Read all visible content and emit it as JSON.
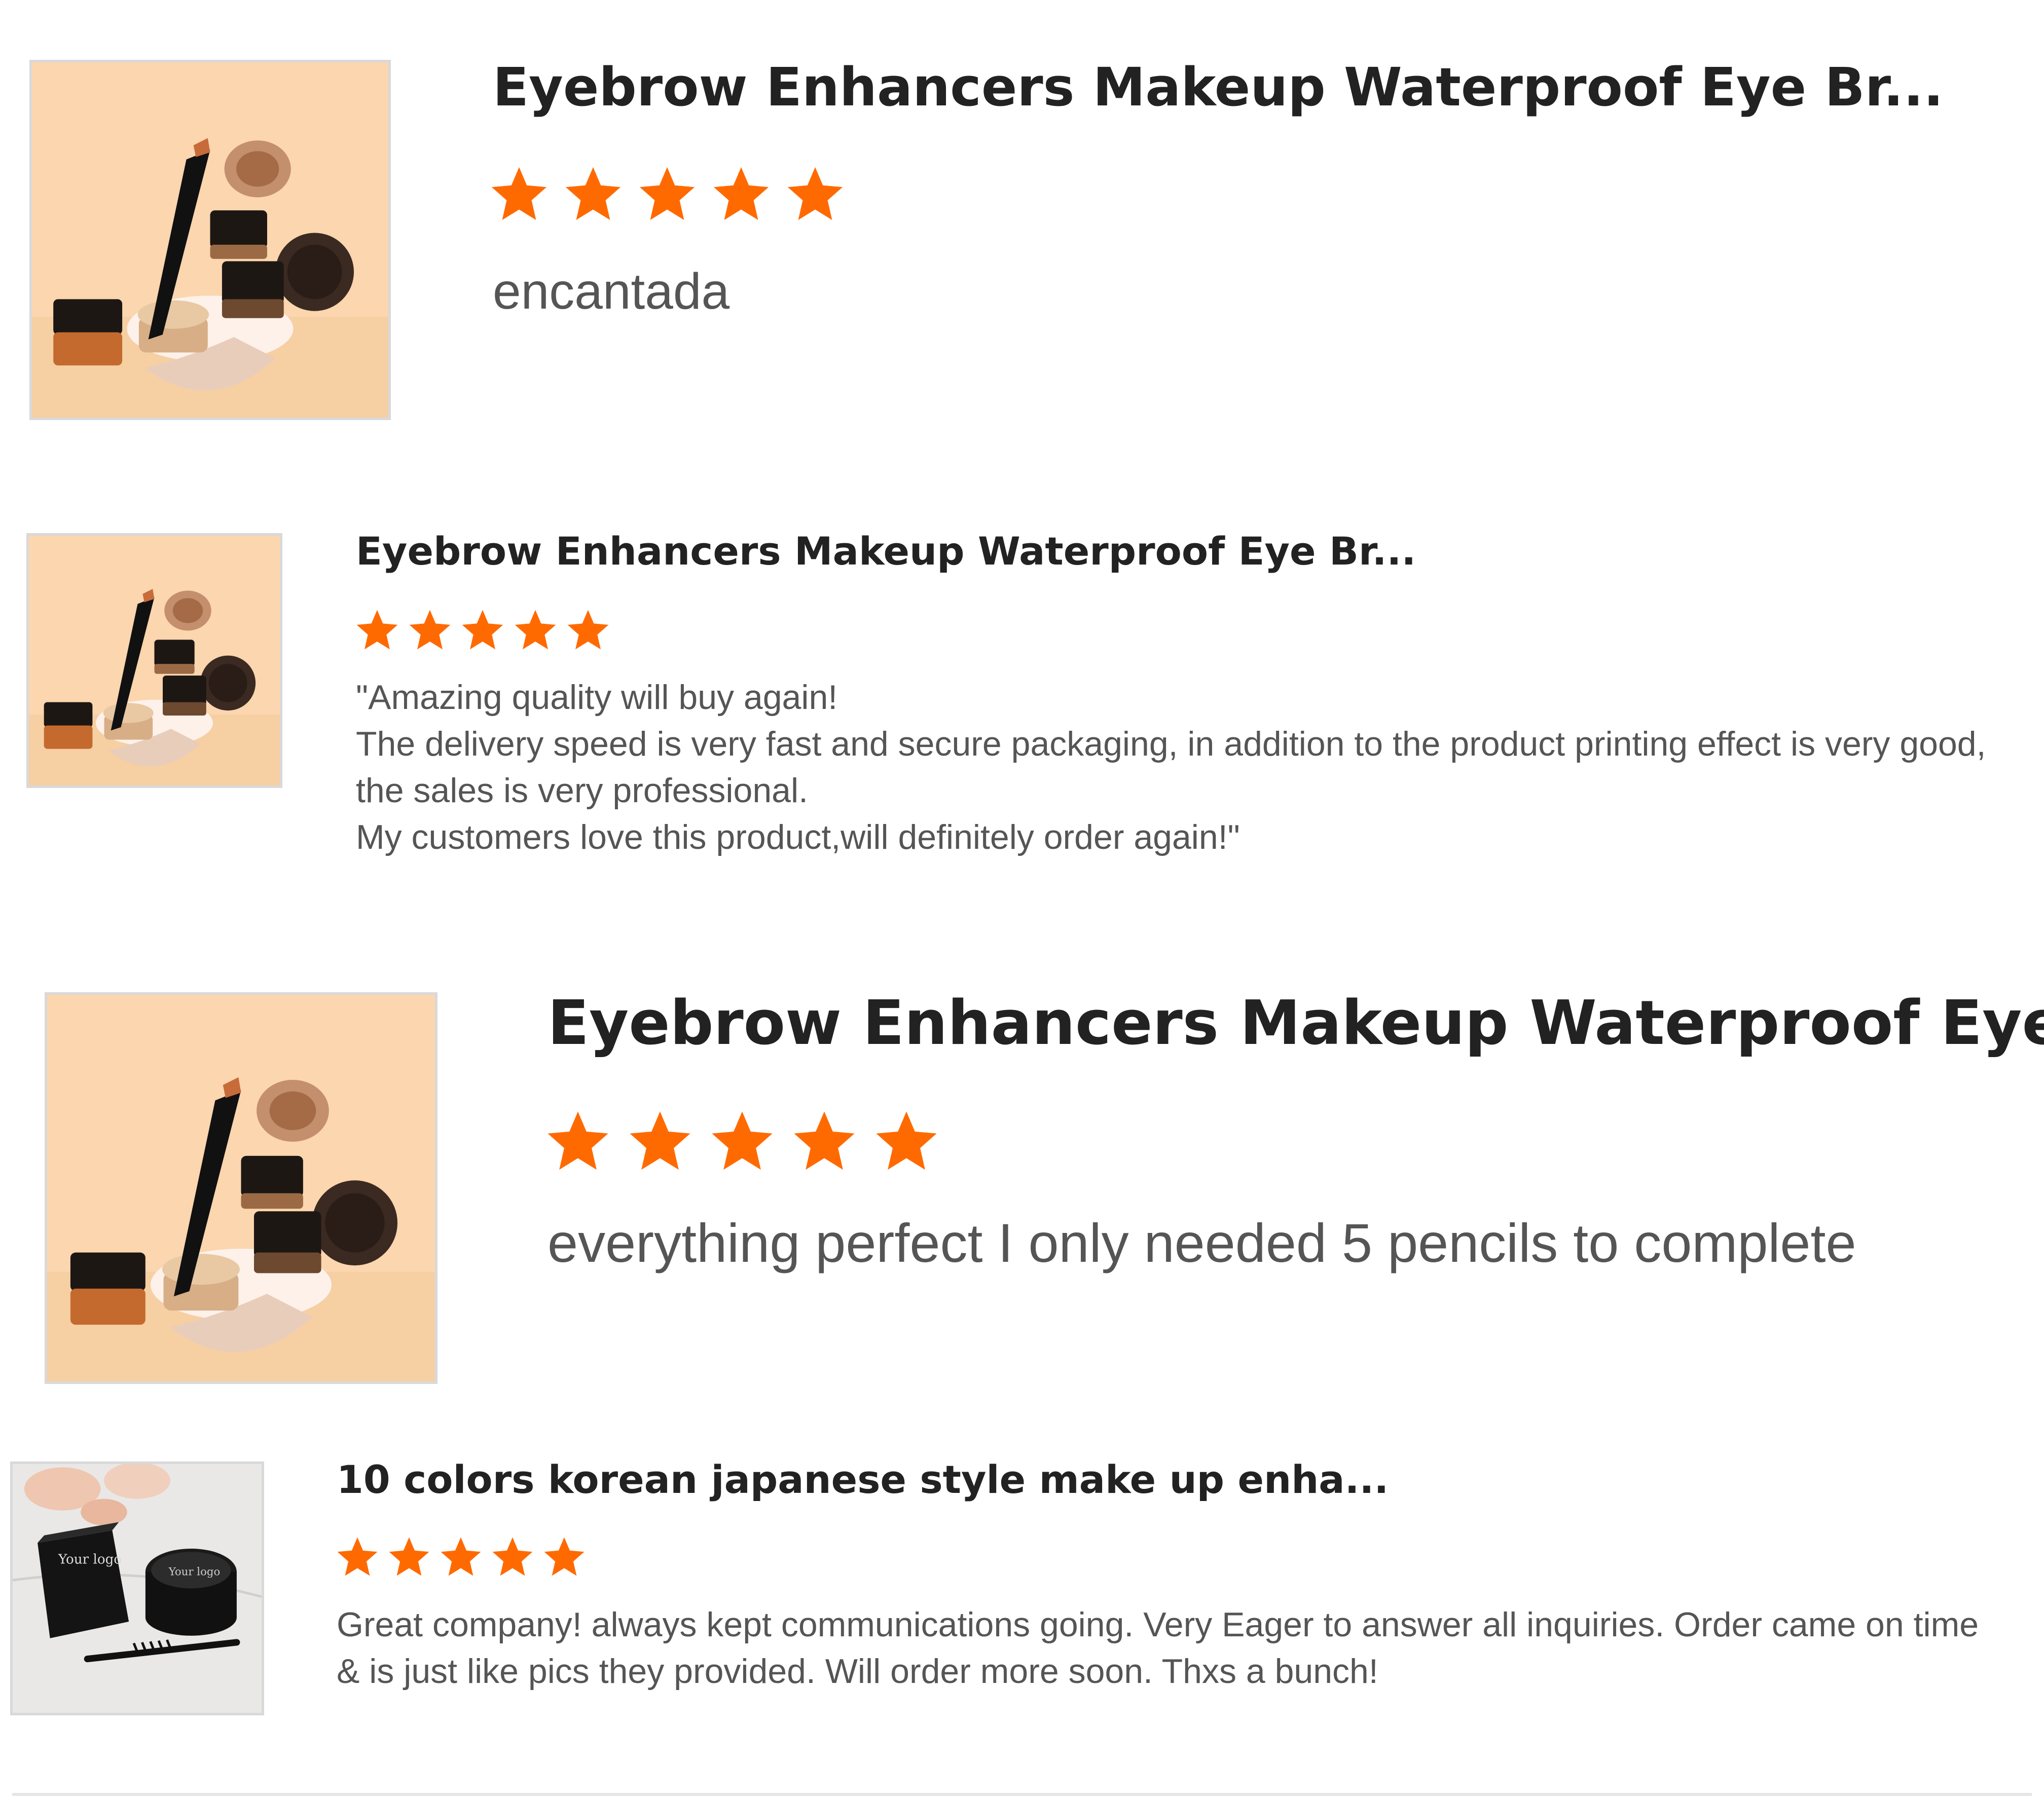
{
  "colors": {
    "star": "#ff6a00",
    "title": "#222222",
    "body": "#555555",
    "thumb_border": "#d9d9d9",
    "divider": "#e6e6e6"
  },
  "star_icon": "star-filled-icon",
  "reviews": [
    {
      "product_title": "Eyebrow Enhancers Makeup Waterproof Eye Br...",
      "rating": 5,
      "text_lines": [
        "encantada"
      ]
    },
    {
      "product_title": "Eyebrow Enhancers Makeup Waterproof Eye Br...",
      "rating": 5,
      "text_lines": [
        "\"Amazing quality will buy again!",
        "The delivery speed is very fast and secure packaging, in addition to the product printing effect is very good,",
        "the sales is very professional.",
        "My customers love this product,will definitely order again!\""
      ]
    },
    {
      "product_title": "Eyebrow Enhancers Makeup Waterproof Eye Br...",
      "rating": 5,
      "text_lines": [
        "everything perfect I only needed 5 pencils to complete"
      ]
    },
    {
      "product_title": "10 colors korean japanese style make up enha...",
      "rating": 5,
      "text_lines": [
        "Great company! always kept communications going. Very Eager to answer all inquiries. Order came on time",
        "& is just like pics they provided. Will order more soon. Thxs a bunch!"
      ]
    }
  ]
}
